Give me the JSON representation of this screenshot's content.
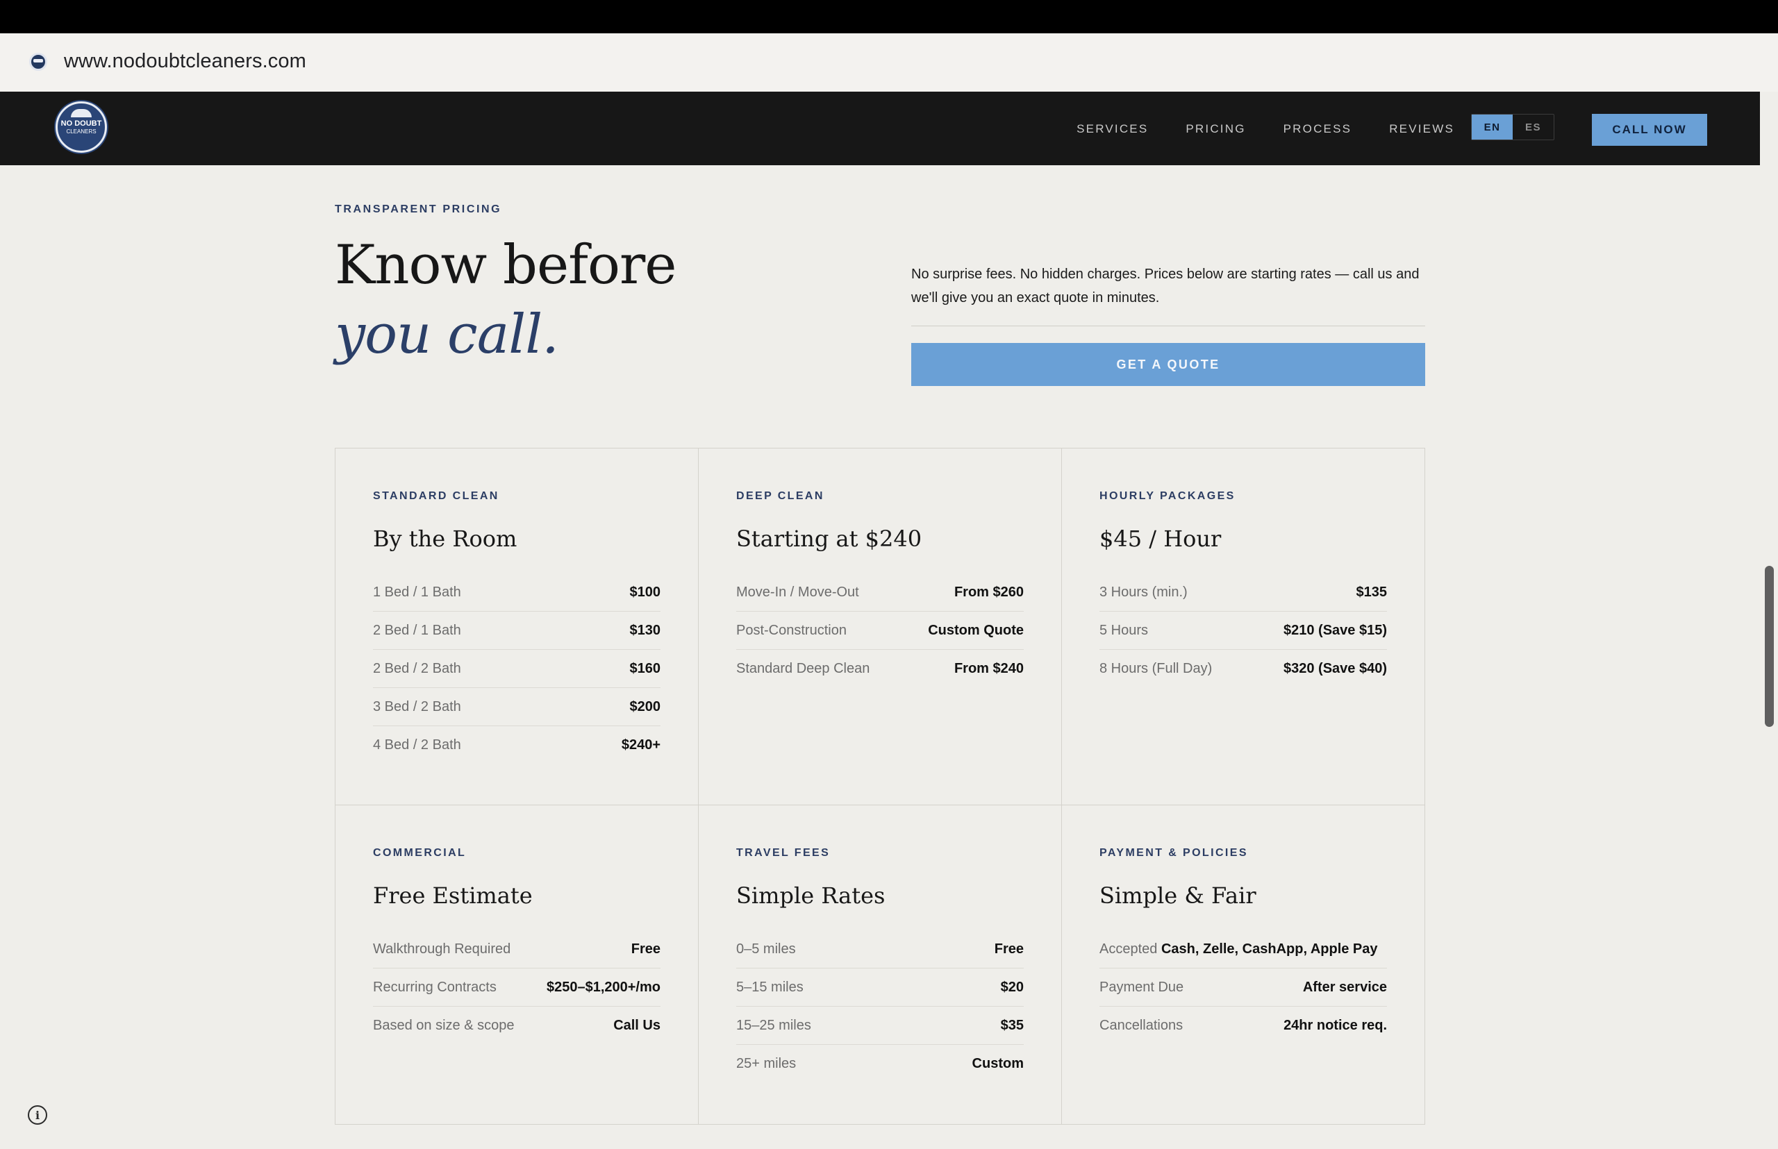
{
  "browser": {
    "url": "www.nodoubtcleaners.com"
  },
  "nav": {
    "logo": {
      "top": "NO DOUBT",
      "bottom": "CLEANERS"
    },
    "links": [
      "SERVICES",
      "PRICING",
      "PROCESS",
      "REVIEWS"
    ],
    "lang": {
      "en": "EN",
      "es": "ES",
      "active": "EN"
    },
    "call_label": "CALL NOW"
  },
  "hero": {
    "eyebrow": "TRANSPARENT PRICING",
    "headline_line1": "Know before",
    "headline_line2": "you call.",
    "intro": "No surprise fees. No hidden charges. Prices below are starting rates — call us and we'll give you an exact quote in minutes.",
    "quote_label": "GET A QUOTE"
  },
  "cards": [
    {
      "eyebrow": "STANDARD CLEAN",
      "title": "By the Room",
      "rows": [
        {
          "label": "1 Bed / 1 Bath",
          "value": "$100"
        },
        {
          "label": "2 Bed / 1 Bath",
          "value": "$130"
        },
        {
          "label": "2 Bed / 2 Bath",
          "value": "$160"
        },
        {
          "label": "3 Bed / 2 Bath",
          "value": "$200"
        },
        {
          "label": "4 Bed / 2 Bath",
          "value": "$240+"
        }
      ]
    },
    {
      "eyebrow": "DEEP CLEAN",
      "title": "Starting at $240",
      "rows": [
        {
          "label": "Move-In / Move-Out",
          "value": "From $260"
        },
        {
          "label": "Post-Construction",
          "value": "Custom Quote"
        },
        {
          "label": "Standard Deep Clean",
          "value": "From $240"
        }
      ]
    },
    {
      "eyebrow": "HOURLY PACKAGES",
      "title": "$45 / Hour",
      "rows": [
        {
          "label": "3 Hours (min.)",
          "value": "$135"
        },
        {
          "label": "5 Hours",
          "value": "$210 (Save $15)"
        },
        {
          "label": "8 Hours (Full Day)",
          "value": "$320 (Save $40)"
        }
      ]
    },
    {
      "eyebrow": "COMMERCIAL",
      "title": "Free Estimate",
      "rows": [
        {
          "label": "Walkthrough Required",
          "value": "Free"
        },
        {
          "label": "Recurring Contracts",
          "value": "$250–$1,200+/mo"
        },
        {
          "label": "Based on size & scope",
          "value": "Call Us"
        }
      ]
    },
    {
      "eyebrow": "TRAVEL FEES",
      "title": "Simple Rates",
      "rows": [
        {
          "label": "0–5 miles",
          "value": "Free"
        },
        {
          "label": "5–15 miles",
          "value": "$20"
        },
        {
          "label": "15–25 miles",
          "value": "$35"
        },
        {
          "label": "25+ miles",
          "value": "Custom"
        }
      ]
    },
    {
      "eyebrow": "PAYMENT & POLICIES",
      "title": "Simple & Fair",
      "rows": [
        {
          "label": "Accepted",
          "inline": "Cash, Zelle, CashApp, Apple Pay",
          "value": ""
        },
        {
          "label": "Payment Due",
          "value": "After service"
        },
        {
          "label": "Cancellations",
          "value": "24hr notice req."
        }
      ]
    }
  ],
  "info_icon": "info-icon",
  "colors": {
    "accent": "#6aa0d6",
    "navy": "#2b3f68",
    "nav_bg": "#171717",
    "page_bg": "#efeeea"
  }
}
